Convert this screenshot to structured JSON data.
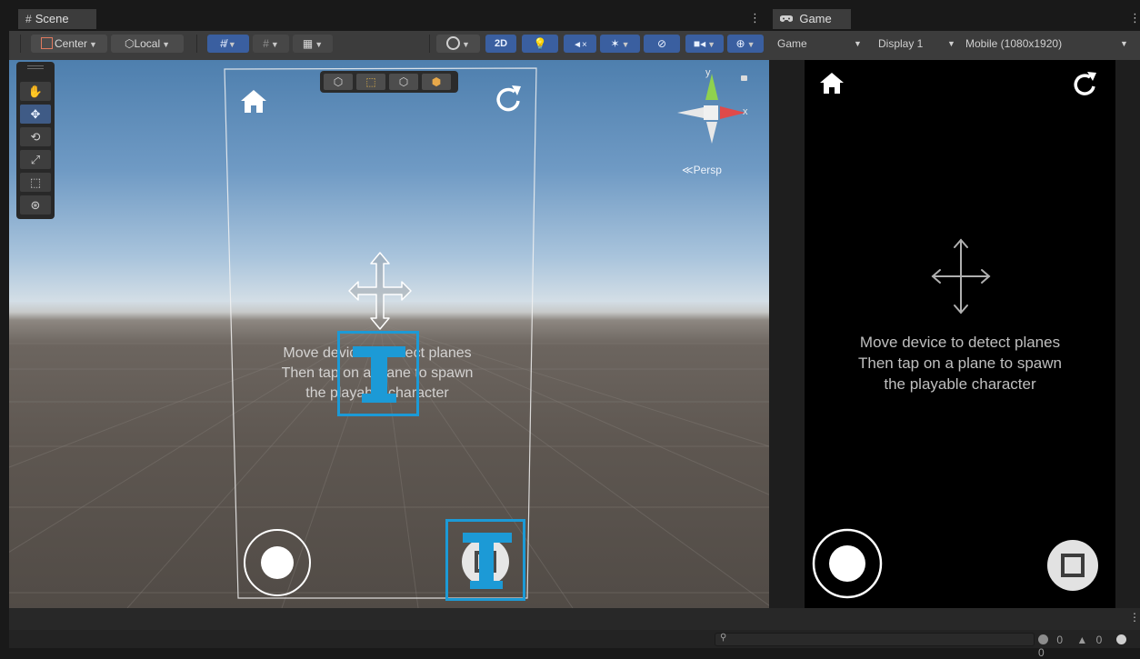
{
  "scene_tab": {
    "icon": "#",
    "label": "Scene"
  },
  "game_tab": {
    "icon": "gamepad-icon",
    "label": "Game"
  },
  "scene_toolbar": {
    "pivot_mode": "Center",
    "pivot_rotation": "Local",
    "mode_2d_label": "2D",
    "overlay_buttons": [
      "image-panel-icon",
      "rect-panel-icon",
      "cube-panel-icon",
      "colored-cube-icon"
    ]
  },
  "left_tools": [
    "hand-tool-icon",
    "move-tool-icon",
    "rotate-tool-icon",
    "scale-tool-icon",
    "rect-tool-icon",
    "transform-tool-icon"
  ],
  "gizmo": {
    "y_label": "y",
    "x_label": "x",
    "projection_label": "≪Persp"
  },
  "scene_ui": {
    "instruction_lines": [
      "Move device to detect planes",
      "Then tap on a plane to spawn",
      "the playable character"
    ]
  },
  "game_toolbar": {
    "view_label": "Game",
    "display_label": "Display 1",
    "resolution_label": "Mobile (1080x1920)"
  },
  "game_ui": {
    "instruction_lines": [
      "Move device to detect planes",
      "Then tap on a plane to spawn",
      "the playable character"
    ]
  },
  "console_counts": {
    "info": "0",
    "warning": "0",
    "error": "0"
  },
  "colors": {
    "accent_blue": "#1c9ad6",
    "active_tool": "#3f5b86",
    "panel": "#3c3c3c"
  }
}
